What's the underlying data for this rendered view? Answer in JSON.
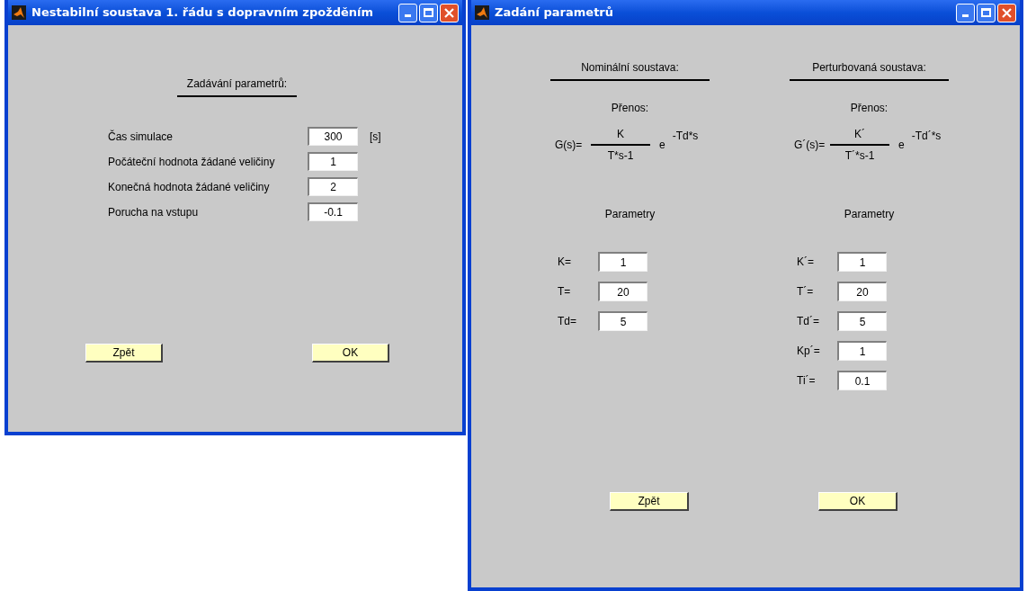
{
  "windows": [
    {
      "kind": "settings",
      "title": "Nestabilní soustava 1. řádu s dopravním zpožděním",
      "heading": "Zadávání parametrů:",
      "fields": [
        {
          "label": "Čas simulace",
          "value": "300",
          "unit": "[s]"
        },
        {
          "label": "Počáteční hodnota žádané veličiny",
          "value": "1"
        },
        {
          "label": "Konečná hodnota žádané veličiny",
          "value": "2"
        },
        {
          "label": "Porucha na vstupu",
          "value": "-0.1"
        }
      ],
      "buttons": [
        "Zpět",
        "OK"
      ]
    },
    {
      "kind": "parameters",
      "title": "Zadání parametrů",
      "columns": [
        {
          "heading": "Nominální soustava:",
          "transfer_label": "Přenos:",
          "formula": {
            "lhs": "G(s)=",
            "numerator": "K",
            "denominator": "T*s-1",
            "base": "e",
            "exponent": "-Td*s"
          },
          "params_label": "Parametry",
          "fields": [
            {
              "label": "K=",
              "value": "1"
            },
            {
              "label": "T=",
              "value": "20"
            },
            {
              "label": "Td=",
              "value": "5"
            }
          ]
        },
        {
          "heading": "Perturbovaná soustava:",
          "transfer_label": "Přenos:",
          "formula": {
            "lhs": "G´(s)=",
            "numerator": "K´",
            "denominator": "T´*s-1",
            "base": "e",
            "exponent": "-Td´*s"
          },
          "params_label": "Parametry",
          "fields": [
            {
              "label": "K´=",
              "value": "1"
            },
            {
              "label": "T´=",
              "value": "20"
            },
            {
              "label": "Td´=",
              "value": "5"
            },
            {
              "label": "Kp´=",
              "value": "1"
            },
            {
              "label": "Ti´=",
              "value": "0.1"
            }
          ]
        }
      ],
      "buttons": [
        "Zpět",
        "OK"
      ]
    }
  ]
}
